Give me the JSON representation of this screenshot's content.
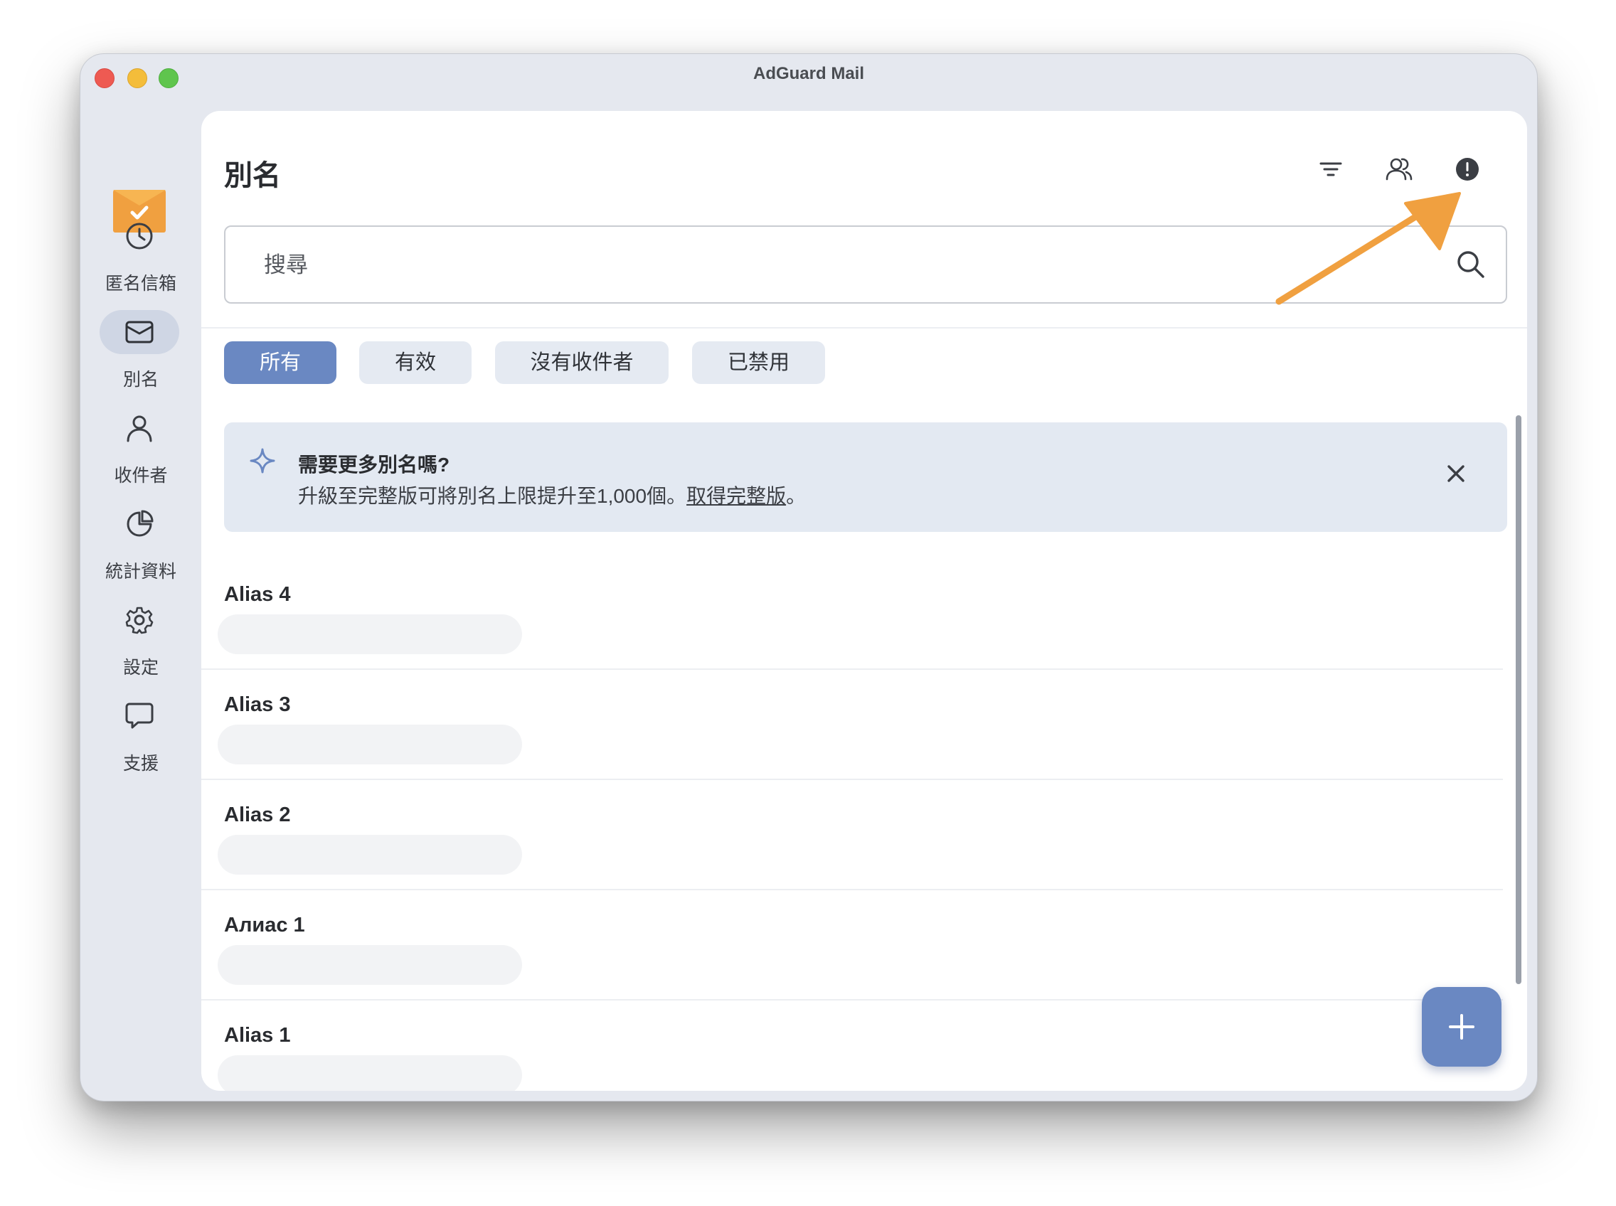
{
  "window": {
    "title": "AdGuard Mail"
  },
  "sidebar": {
    "items": [
      {
        "label": "匿名信箱",
        "icon": "clock-icon"
      },
      {
        "label": "別名",
        "icon": "envelope-icon"
      },
      {
        "label": "收件者",
        "icon": "person-icon"
      },
      {
        "label": "統計資料",
        "icon": "pie-chart-icon"
      },
      {
        "label": "設定",
        "icon": "gear-icon"
      },
      {
        "label": "支援",
        "icon": "chat-bubble-icon"
      }
    ],
    "active_index": 1
  },
  "header": {
    "title": "別名"
  },
  "search": {
    "placeholder": "搜尋",
    "value": ""
  },
  "filters": {
    "tabs": [
      "所有",
      "有效",
      "沒有收件者",
      "已禁用"
    ],
    "active_index": 0
  },
  "banner": {
    "title": "需要更多別名嗎?",
    "text_before": "升級至完整版可將別名上限提升至1,000個。",
    "link": "取得完整版",
    "text_after": "。"
  },
  "aliases": [
    {
      "name": "Alias 4"
    },
    {
      "name": "Alias 3"
    },
    {
      "name": "Alias 2"
    },
    {
      "name": "Алиас 1"
    },
    {
      "name": "Alias 1"
    }
  ],
  "colors": {
    "accent": "#6a88c2",
    "annotation_arrow": "#f0a040",
    "logo": "#f0a040"
  }
}
